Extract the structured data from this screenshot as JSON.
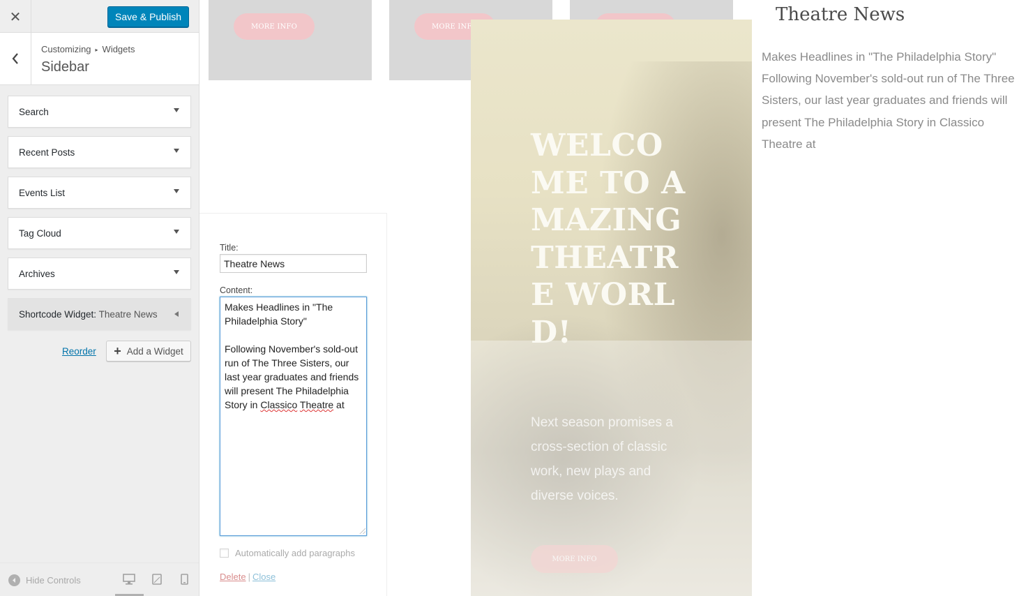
{
  "header": {
    "close_symbol": "✕",
    "save_label": "Save & Publish"
  },
  "section": {
    "breadcrumb_root": "Customizing",
    "breadcrumb_separator": "▸",
    "breadcrumb_child": "Widgets",
    "title": "Sidebar"
  },
  "widgets": [
    {
      "title": "Search"
    },
    {
      "title": "Recent Posts"
    },
    {
      "title": "Events List"
    },
    {
      "title": "Tag Cloud"
    },
    {
      "title": "Archives"
    }
  ],
  "open_widget": {
    "title": "Shortcode Widget:",
    "subtitle": "Theatre News"
  },
  "actions": {
    "reorder_label": "Reorder",
    "add_widget_label": "Add a Widget",
    "add_icon": "+"
  },
  "footer": {
    "hide_controls_label": "Hide Controls"
  },
  "preview": {
    "thumb_button_label": "MORE INFO",
    "hero_title": "WELCOME TO AMAZING THEATRE WORLD!",
    "hero_subtitle": "Next season promises a cross-section of classic work, new plays and diverse voices.",
    "hero_button_label": "MORE INFO",
    "news_title": "Theatre News",
    "news_body": "Makes Headlines in \"The Philadelphia Story\" Following November's sold-out run of The Three Sisters, our last year graduates and friends will present The Philadelphia Story in Classico Theatre at"
  },
  "form": {
    "title_label": "Title:",
    "title_value": "Theatre News",
    "content_label": "Content:",
    "content_line1": "Makes Headlines in \"The Philadelphia Story\"",
    "content_line2": "Following November's sold-out run of The Three Sisters, our last year graduates and friends will present The Philadelphia Story in ",
    "content_misspelled1": "Classico",
    "content_misspelled2": "Theatre",
    "content_tail": " at",
    "auto_paragraphs_label": "Automatically add paragraphs",
    "auto_paragraphs_checked": false,
    "delete_label": "Delete",
    "link_separator": "|",
    "close_label": "Close"
  },
  "colors": {
    "primary_button": "#0085ba",
    "pink_button": "#f2c6c9",
    "link": "#0073aa",
    "delete": "#aa0000"
  }
}
